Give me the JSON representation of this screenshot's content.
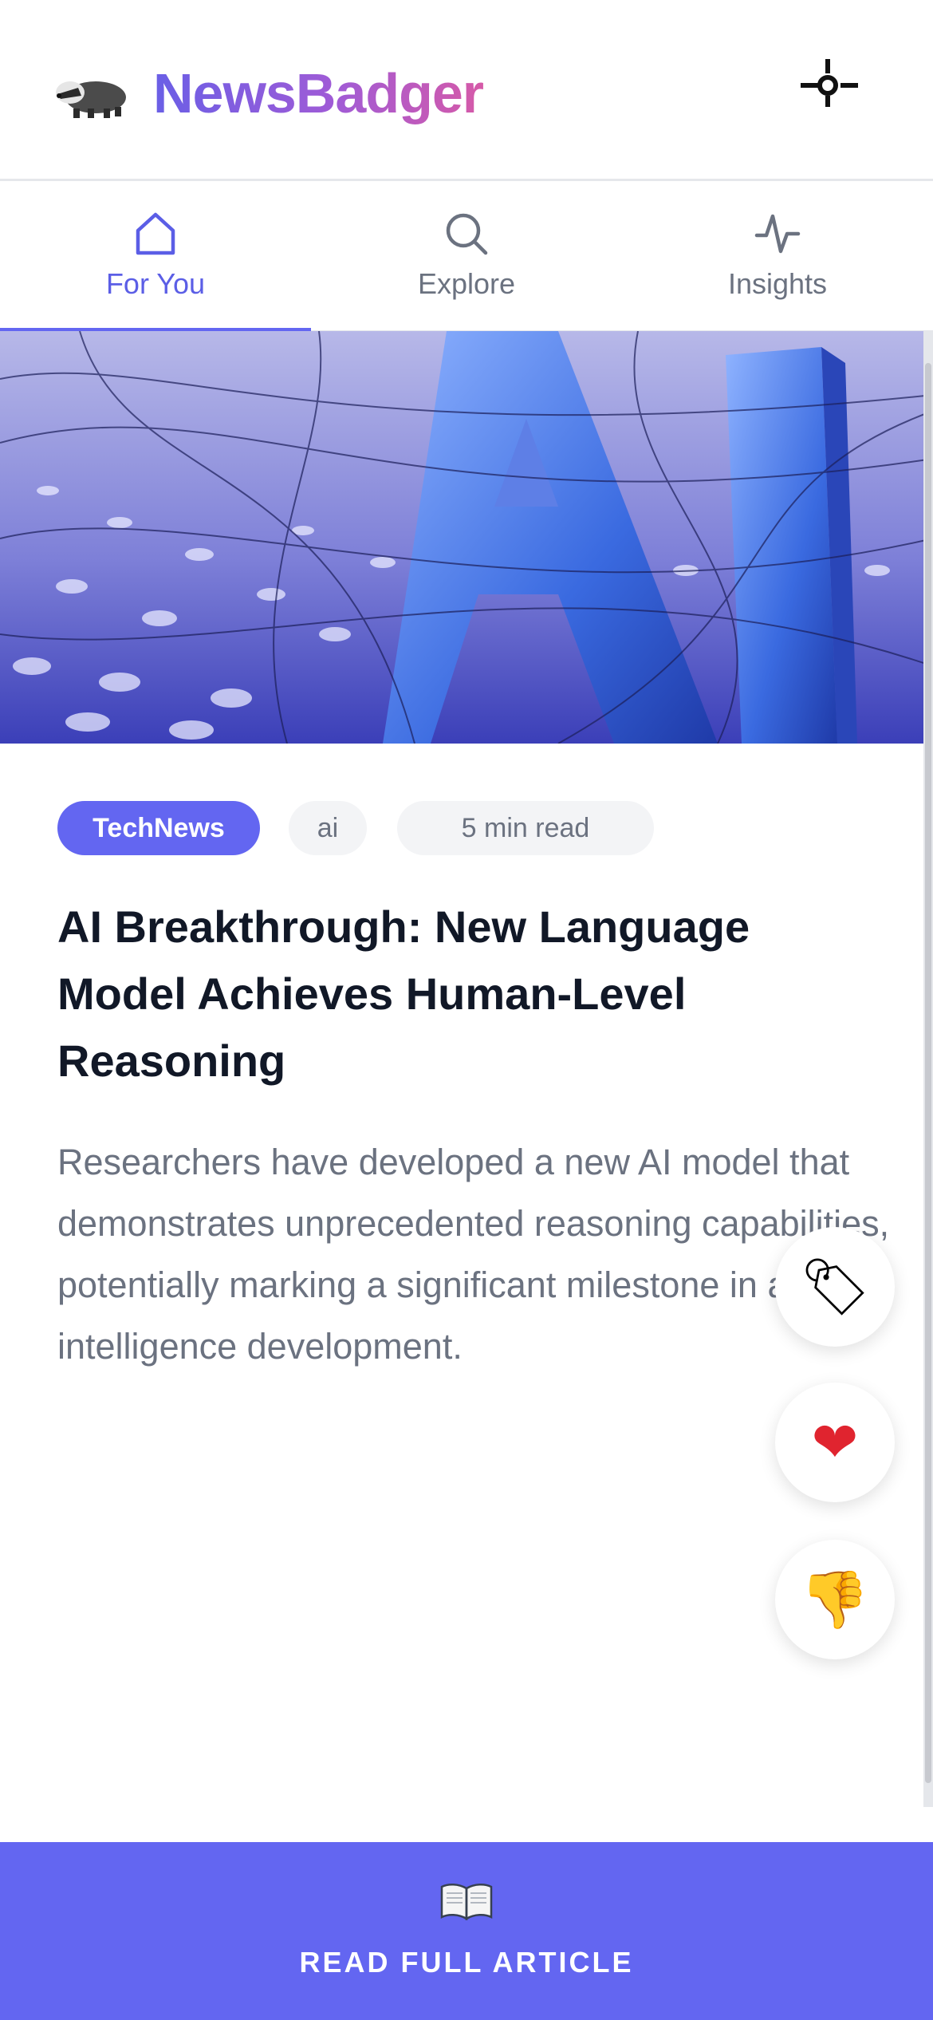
{
  "header": {
    "title": "NewsBadger"
  },
  "tabs": [
    {
      "label": "For You",
      "active": true
    },
    {
      "label": "Explore",
      "active": false
    },
    {
      "label": "Insights",
      "active": false
    }
  ],
  "article": {
    "tags": {
      "source": "TechNews",
      "topic": "ai",
      "read_time": "5 min read"
    },
    "headline": "AI Breakthrough: New Language Model Achieves Human-Level Reasoning",
    "summary": "Researchers have developed a new AI model that demonstrates unprecedented reasoning capabilities, potentially marking a significant milestone in artificial intelligence development.",
    "hero_image_text": "AI"
  },
  "actions": [
    {
      "icon": "tag-icon",
      "glyph": "🏷"
    },
    {
      "icon": "heart-icon",
      "glyph": "❤"
    },
    {
      "icon": "thumbs-down-icon",
      "glyph": "👎"
    }
  ],
  "footer": {
    "cta_label": "READ FULL ARTICLE",
    "icon": "open-book-icon"
  },
  "colors": {
    "accent": "#6366f1",
    "text": "#111827",
    "muted": "#6b7280"
  }
}
